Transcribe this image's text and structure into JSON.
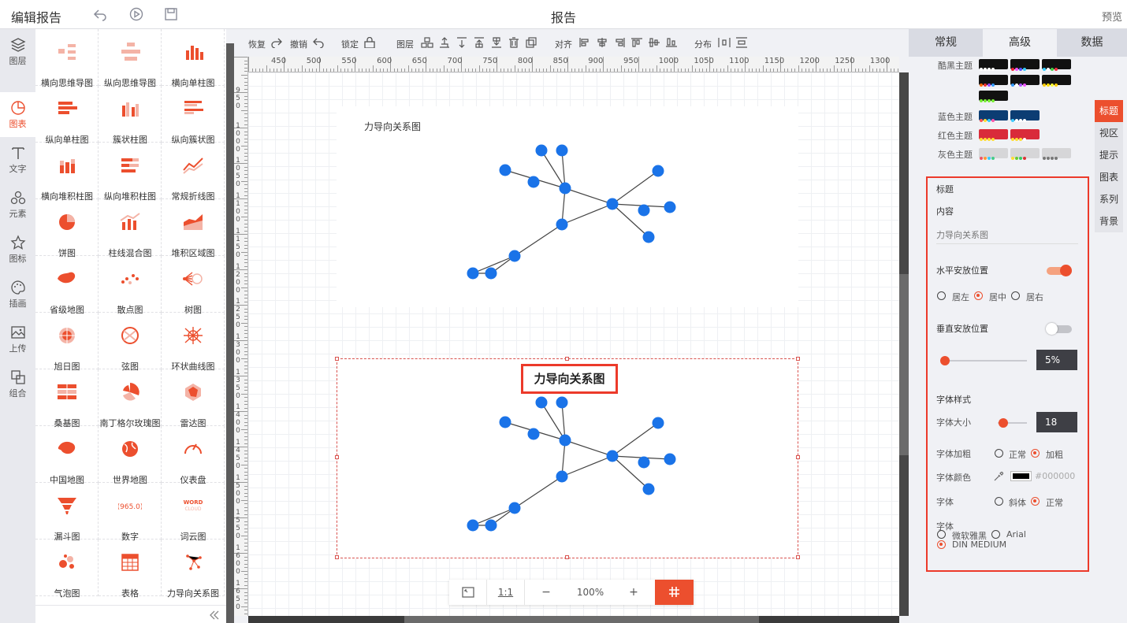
{
  "header": {
    "title": "编辑报告",
    "center_title": "报告",
    "preview": "预览"
  },
  "left_nav": [
    {
      "label": "图层",
      "icon": "layers-icon"
    },
    {
      "label": "图表",
      "icon": "chart-pie-icon"
    },
    {
      "label": "文字",
      "icon": "text-icon"
    },
    {
      "label": "元素",
      "icon": "elements-icon"
    },
    {
      "label": "图标",
      "icon": "star-icon"
    },
    {
      "label": "插画",
      "icon": "palette-icon"
    },
    {
      "label": "上传",
      "icon": "image-upload-icon"
    },
    {
      "label": "组合",
      "icon": "group-icon"
    }
  ],
  "chart_library": [
    "横向思维导图",
    "纵向思维导图",
    "横向单柱图",
    "纵向单柱图",
    "簇状柱图",
    "纵向簇状图",
    "横向堆积柱图",
    "纵向堆积柱图",
    "常规折线图",
    "饼图",
    "柱线混合图",
    "堆积区域图",
    "省级地图",
    "散点图",
    "树图",
    "旭日图",
    "弦图",
    "环状曲线图",
    "桑基图",
    "南丁格尔玫瑰图",
    "雷达图",
    "中国地图",
    "世界地图",
    "仪表盘",
    "漏斗图",
    "数字",
    "词云图",
    "气泡图",
    "表格",
    "力导向关系图"
  ],
  "toolbar": {
    "redo": "恢复",
    "undo": "撤销",
    "lock": "锁定",
    "layer": "图层",
    "align": "对齐",
    "distribute": "分布"
  },
  "ruler": {
    "h": [
      "450",
      "500",
      "550",
      "600",
      "650",
      "700",
      "750",
      "800",
      "850",
      "900",
      "950",
      "1000",
      "1050",
      "1100",
      "1150",
      "1200",
      "1250",
      "1300"
    ],
    "v": [
      "950",
      "1000",
      "1050",
      "1100",
      "1150",
      "1200",
      "1250",
      "1300",
      "1350",
      "1400",
      "1450",
      "1500",
      "1550",
      "1600",
      "1650"
    ]
  },
  "chart1": {
    "title": "力导向关系图"
  },
  "chart2": {
    "title": "力导向关系图"
  },
  "zoom": {
    "fit": "⤢",
    "ratio": "1:1",
    "minus": "−",
    "level": "100%",
    "plus": "+"
  },
  "panel": {
    "tabs": [
      "常规",
      "高级",
      "数据"
    ],
    "themes": [
      {
        "label": "酷黑主题",
        "swatches": [
          [
            "#fff",
            "#fff",
            "#fff",
            "#fff"
          ],
          [
            "#e23",
            "#e5f",
            "#55f",
            "#3cf"
          ],
          [
            "#3cf",
            "#fff",
            "#4c4",
            "#e34"
          ]
        ]
      },
      {
        "label": "",
        "swatches": [
          [
            "#f60",
            "#e33",
            "#94f",
            "#39f"
          ],
          [
            "#39f",
            "#fff",
            "#a5f",
            "#e5f"
          ],
          [
            "#fc0",
            "#fd0",
            "#ff3",
            "#fc0"
          ]
        ]
      },
      {
        "label": "",
        "swatches": [
          [
            "#7e3",
            "#7e3",
            "#7e3",
            "#7e3"
          ]
        ]
      },
      {
        "label": "蓝色主题",
        "swatches": [
          [
            "#f55",
            "#fd3",
            "#3cf",
            "#f5a"
          ],
          [
            "#4cf",
            "#fff",
            "#fff",
            "#fff"
          ]
        ]
      },
      {
        "label": "红色主题",
        "swatches": [
          [
            "#fd3",
            "#fd3",
            "#fd3",
            "#fd3"
          ],
          [
            "#fd3",
            "#fd3",
            "#fd3",
            "#fff"
          ]
        ]
      },
      {
        "label": "灰色主题",
        "swatches": [
          [
            "#e56",
            "#f93",
            "#3cf",
            "#4c8"
          ],
          [
            "#fd3",
            "#6c3",
            "#3c6",
            "#d33"
          ],
          [
            "#777",
            "#777",
            "#777",
            "#777"
          ]
        ]
      }
    ],
    "side_tabs": [
      "标题",
      "视区",
      "提示",
      "图表",
      "系列",
      "背景"
    ],
    "title_section": "标题",
    "content_label": "内容",
    "content_value": "力导向关系图",
    "h_position": {
      "label": "水平安放位置",
      "enabled": true,
      "options": [
        "居左",
        "居中",
        "居右"
      ],
      "selected": "居中"
    },
    "v_position": {
      "label": "垂直安放位置",
      "enabled": false,
      "value": "5%",
      "fraction": 0.05
    },
    "font_style": "字体样式",
    "font_size": {
      "label": "字体大小",
      "value": "18",
      "fraction": 0.18
    },
    "font_bold": {
      "label": "字体加粗",
      "options": [
        "正常",
        "加粗"
      ],
      "selected": "加粗"
    },
    "font_color": {
      "label": "字体颜色",
      "value": "#000000"
    },
    "font_italic": {
      "label": "字体",
      "options": [
        "斜体",
        "正常"
      ],
      "selected": "正常"
    },
    "font_family": {
      "label": "字体",
      "options": [
        "微软雅黑",
        "Arial",
        "DIN MEDIUM"
      ],
      "selected": "DIN MEDIUM"
    }
  },
  "colors": {
    "accent": "#ec4f2e",
    "node": "#1a73e8",
    "highlight": "#ec3a2a"
  }
}
